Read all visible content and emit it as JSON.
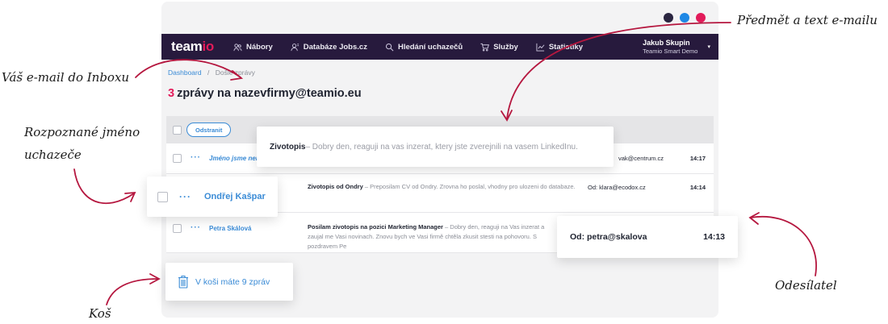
{
  "colors": {
    "brand_dark": "#271a3d",
    "brand_accent": "#e21b5a",
    "link_blue": "#3a8bd6",
    "annotation_arrow": "#b5173f",
    "window_dots": [
      "#2a2540",
      "#1e88e5",
      "#e21b5a"
    ]
  },
  "app": {
    "logo": {
      "main": "team",
      "accent": "io"
    },
    "nav": [
      {
        "label": "Nábory",
        "icon": "users-icon"
      },
      {
        "label": "Databáze Jobs.cz",
        "icon": "database-users-icon"
      },
      {
        "label": "Hledání uchazečů",
        "icon": "search-icon"
      },
      {
        "label": "Služby",
        "icon": "cart-icon"
      },
      {
        "label": "Statistiky",
        "icon": "chart-icon"
      }
    ],
    "user": {
      "name": "Jakub Skupin",
      "company": "Teamio Smart Demo",
      "chevron": "▾"
    },
    "breadcrumb": {
      "home": "Dashboard",
      "separator": "/",
      "current": "Došlé zprávy"
    },
    "title": {
      "count": "3",
      "text": "zprávy na nazevfirmy@teamio.eu"
    },
    "toolbar": {
      "delete_label": "Odstranit"
    },
    "rows": [
      {
        "more": "···",
        "name": "Jméno jsme nen",
        "subject": "",
        "excerpt": "",
        "from": "vak@centrum.cz",
        "time": "14:17"
      },
      {
        "more": "···",
        "name": "",
        "subject": "Zivotopis od Ondry",
        "excerpt": " – Preposilam CV od Ondry. Zrovna ho poslal, vhodny pro ulozeni do databaze.",
        "from": "Od: klara@ecodox.cz",
        "time": "14:14"
      },
      {
        "more": "···",
        "name": "Petra Skálová",
        "subject": "Posilam zivotopis na pozici Marketing Manager",
        "excerpt": " – Dobry den, reaguji na Vas inzerat a zaujal me Vasi novinach. Znovu bych ve Vasi firmě chtěla zkusit stesti na pohovoru. S pozdravem Pe",
        "from": "",
        "time": ""
      }
    ]
  },
  "callouts": {
    "subject": {
      "title": "Zivotopis",
      "excerpt": " – Dobry den, reaguji na vas inzerat, ktery jste zverejnili na vasem LinkedInu."
    },
    "candidate": {
      "more": "···",
      "name": "Ondřej Kašpar"
    },
    "sender": {
      "from": "Od: petra@skalova",
      "time": "14:13"
    },
    "trash": {
      "text": "V koši máte 9 zpráv"
    }
  },
  "annotations": {
    "inbox": "Váš e-mail do Inboxu",
    "subject": "Předmět a text e-mailu",
    "candidate_line1": "Rozpoznané jméno",
    "candidate_line2": "uchazeče",
    "trash": "Koš",
    "sender": "Odesílatel"
  }
}
